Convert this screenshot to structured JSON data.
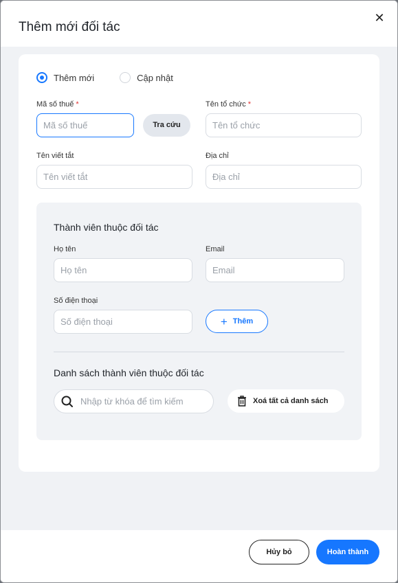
{
  "modal": {
    "title": "Thêm mới đối tác",
    "close_glyph": "✕"
  },
  "mode": {
    "options": [
      "Thêm mới",
      "Cập nhật"
    ],
    "selected": "Thêm mới"
  },
  "form": {
    "tax_code": {
      "label": "Mã số thuế",
      "required_mark": "*",
      "placeholder": "Mã số thuế",
      "value": ""
    },
    "lookup_button": "Tra cứu",
    "org_name": {
      "label": "Tên tổ chức",
      "required_mark": "*",
      "placeholder": "Tên tổ chức",
      "value": ""
    },
    "short_name": {
      "label": "Tên viết tắt",
      "placeholder": "Tên viết tắt",
      "value": ""
    },
    "address": {
      "label": "Địa chỉ",
      "placeholder": "Địa chỉ",
      "value": ""
    }
  },
  "members": {
    "title": "Thành viên thuộc đối tác",
    "full_name": {
      "label": "Họ tên",
      "placeholder": "Họ tên"
    },
    "email": {
      "label": "Email",
      "placeholder": "Email"
    },
    "phone": {
      "label": "Số điện thoại",
      "placeholder": "Số điện thoại"
    },
    "add_button": "Thêm",
    "list_title": "Danh sách thành viên thuộc đối tác",
    "search_placeholder": "Nhập từ khóa để tìm kiếm",
    "clear_all_button": "Xoá tất cả danh sách"
  },
  "footer": {
    "cancel_label": "Hủy bỏ",
    "done_label": "Hoàn thành"
  },
  "colors": {
    "accent": "#1677ff",
    "required": "#e03131"
  }
}
